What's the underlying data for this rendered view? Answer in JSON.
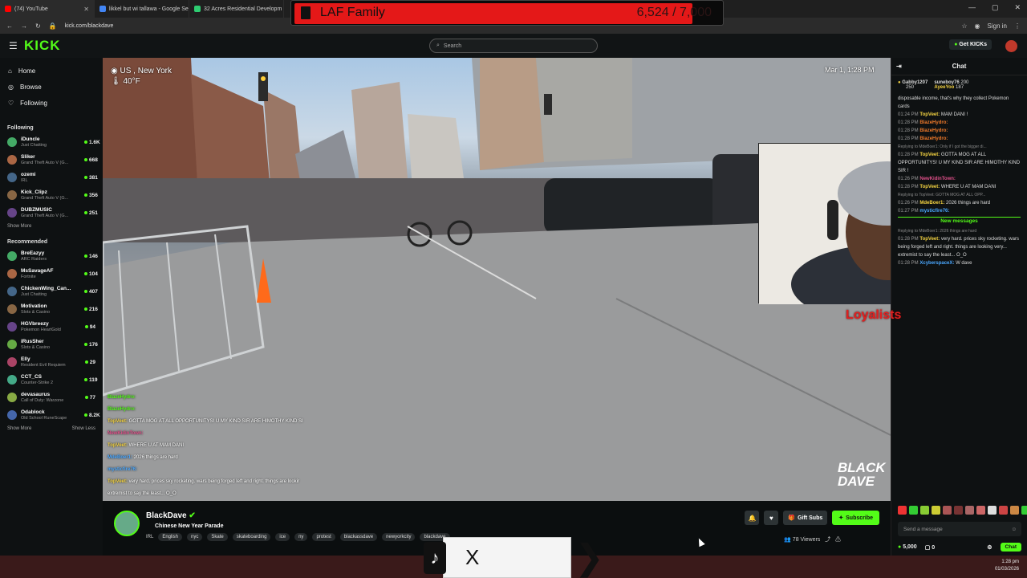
{
  "browser": {
    "tabs": [
      {
        "title": "(74) YouTube",
        "fav": "#ff0000"
      },
      {
        "title": "likkel but wi tallawa - Google Se",
        "fav": "#4285f4"
      },
      {
        "title": "32 Acres Residential Developm",
        "fav": "#2ecc71"
      }
    ],
    "url": "kick.com/blackdave",
    "sign_in": "Sign in"
  },
  "banner": {
    "title": "LAF Family",
    "count": "6,524 / 7,000",
    "progress": 0.932
  },
  "kick": {
    "logo": "KICK",
    "search_placeholder": "Search",
    "get_kicks": "Get KICKs"
  },
  "sidebar": {
    "nav": [
      {
        "label": "Home",
        "icon": "home-icon"
      },
      {
        "label": "Browse",
        "icon": "browse-icon"
      },
      {
        "label": "Following",
        "icon": "heart-icon"
      }
    ],
    "following_title": "Following",
    "following": [
      {
        "name": "iDuncle",
        "game": "Just Chatting",
        "viewers": "1.6K"
      },
      {
        "name": "Sliker",
        "game": "Grand Theft Auto V (G...",
        "viewers": "668"
      },
      {
        "name": "ozemi",
        "game": "IRL",
        "viewers": "381"
      },
      {
        "name": "Kick_Clipz",
        "game": "Grand Theft Auto V (G...",
        "viewers": "356"
      },
      {
        "name": "DUBZMUSIC",
        "game": "Grand Theft Auto V (G...",
        "viewers": "251"
      }
    ],
    "show_more": "Show More",
    "recommended_title": "Recommended",
    "recommended": [
      {
        "name": "BreEazyy",
        "game": "ARC Raiders",
        "viewers": "146"
      },
      {
        "name": "MsSavageAF",
        "game": "Fortnite",
        "viewers": "104"
      },
      {
        "name": "ChickenWing_Can...",
        "game": "Just Chatting",
        "viewers": "407"
      },
      {
        "name": "Motivation",
        "game": "Slots & Casino",
        "viewers": "216"
      },
      {
        "name": "HGVbreezy",
        "game": "Pokemon HeartGold",
        "viewers": "94"
      },
      {
        "name": "iRusSher",
        "game": "Slots & Casino",
        "viewers": "176"
      },
      {
        "name": "Elly",
        "game": "Resident Evil Requiem",
        "viewers": "29"
      },
      {
        "name": "CCT_CS",
        "game": "Counter-Strike 2",
        "viewers": "119"
      },
      {
        "name": "devasaurus",
        "game": "Call of Duty: Warzone",
        "viewers": "77"
      },
      {
        "name": "Odablock",
        "game": "Old School RuneScape",
        "viewers": "8.2K"
      }
    ],
    "show_more2": "Show More",
    "show_less": "Show Less"
  },
  "video": {
    "location": "US , New York",
    "temp": "40°F",
    "datetime": "Mar 1, 1:28 PM",
    "watermark": "BLACK DAVE",
    "overlay_text": "Loyalists",
    "chat_overlay": [
      {
        "user": "BlazeHydro:",
        "text": ""
      },
      {
        "user": "BlazeHydro:",
        "text": ""
      },
      {
        "user": "TopVeet:",
        "text": "GOTTA MOG AT ALL OPPORTUNITYS! U MY KIND SIR ARE HIMOTHY KIND SI"
      },
      {
        "user": "NewKidinTown:",
        "text": ""
      },
      {
        "user": "TopVeet:",
        "text": "WHERE U AT MAM DANI"
      },
      {
        "user": "MdeBoer1:",
        "text": "2026 things are hard"
      },
      {
        "user": "mysticfire76:",
        "text": ""
      },
      {
        "user": "TopVeet:",
        "text": "very hard. prices sky rocketing. wars being forged left and right. things are lookir"
      },
      {
        "user": "",
        "text": "extremist to say the least... O_O"
      },
      {
        "user": "XcyberspaceX:",
        "text": "W dave"
      }
    ]
  },
  "stream": {
    "name": "BlackDave",
    "title": "Chinese New Year Parade",
    "category": "IRL",
    "tags": [
      "English",
      "nyc",
      "Skate",
      "skateboarding",
      "ice",
      "ny",
      "protest",
      "blackassdave",
      "newyorkcity",
      "blackdave"
    ],
    "gift_subs": "Gift Subs",
    "subscribe": "Subscribe",
    "viewers": "78 Viewers"
  },
  "chat": {
    "title": "Chat",
    "top": [
      {
        "name": "Gabby1207",
        "val": "250"
      },
      {
        "name": "suneboy76",
        "val": "200"
      },
      {
        "name": "AyeeYoo",
        "val": "187"
      }
    ],
    "messages": [
      {
        "time": "",
        "user": "",
        "text": "disposable income, that's why they collect Pokemon cards",
        "color": "#ddd"
      },
      {
        "time": "01:24 PM",
        "user": "TopVeet:",
        "text": "MAM DANI !",
        "color": "#f5d442"
      },
      {
        "time": "01:28 PM",
        "user": "BlazeHydro:",
        "text": "",
        "color": "#f07a2a"
      },
      {
        "time": "01:28 PM",
        "user": "BlazeHydro:",
        "text": "",
        "color": "#f07a2a"
      },
      {
        "time": "01:28 PM",
        "user": "BlazeHydro:",
        "text": "",
        "color": "#f07a2a"
      },
      {
        "time": "",
        "user": "",
        "text": "Replying to MdeBoer1: Only if I got the bigger di...",
        "color": "#888",
        "reply": true
      },
      {
        "time": "01:28 PM",
        "user": "TopVeet:",
        "text": "GOTTA MOG AT ALL OPPORTUNITYS! U MY KIND SIR ARE HIMOTHY KIND SIR !",
        "color": "#f5d442"
      },
      {
        "time": "01:26 PM",
        "user": "NewKidinTown:",
        "text": "",
        "color": "#e0508a"
      },
      {
        "time": "01:28 PM",
        "user": "TopVeet:",
        "text": "WHERE U AT MAM DANI",
        "color": "#f5d442"
      },
      {
        "time": "",
        "user": "",
        "text": "Replying to TopVeet: GOTTA MOG AT ALL OPP...",
        "color": "#888",
        "reply": true
      },
      {
        "time": "01:26 PM",
        "user": "MdeBoer1:",
        "text": "2026 things are hard",
        "color": "#f5d442"
      },
      {
        "time": "01:27 PM",
        "user": "mysticfire76:",
        "text": "",
        "color": "#4aa8ff"
      }
    ],
    "new_messages": "New messages",
    "messages2": [
      {
        "time": "",
        "user": "",
        "text": "Replying to MdeBoer1: 2026 things are hard",
        "color": "#888",
        "reply": true
      },
      {
        "time": "01:28 PM",
        "user": "TopVeet:",
        "text": "very hard. prices sky rocketing. wars being forged left and right. things are looking very... extremist to say the least... O_O",
        "color": "#f5d442"
      },
      {
        "time": "01:28 PM",
        "user": "XcyberspaceX:",
        "text": "W dave",
        "color": "#4aa8ff"
      }
    ],
    "send_placeholder": "Send a message",
    "kicks": "5,000",
    "count": "0",
    "chat_button": "Chat"
  },
  "tiktok": {
    "text": "X"
  },
  "tray": {
    "time": "1:28 pm",
    "date": "01/03/2026"
  }
}
